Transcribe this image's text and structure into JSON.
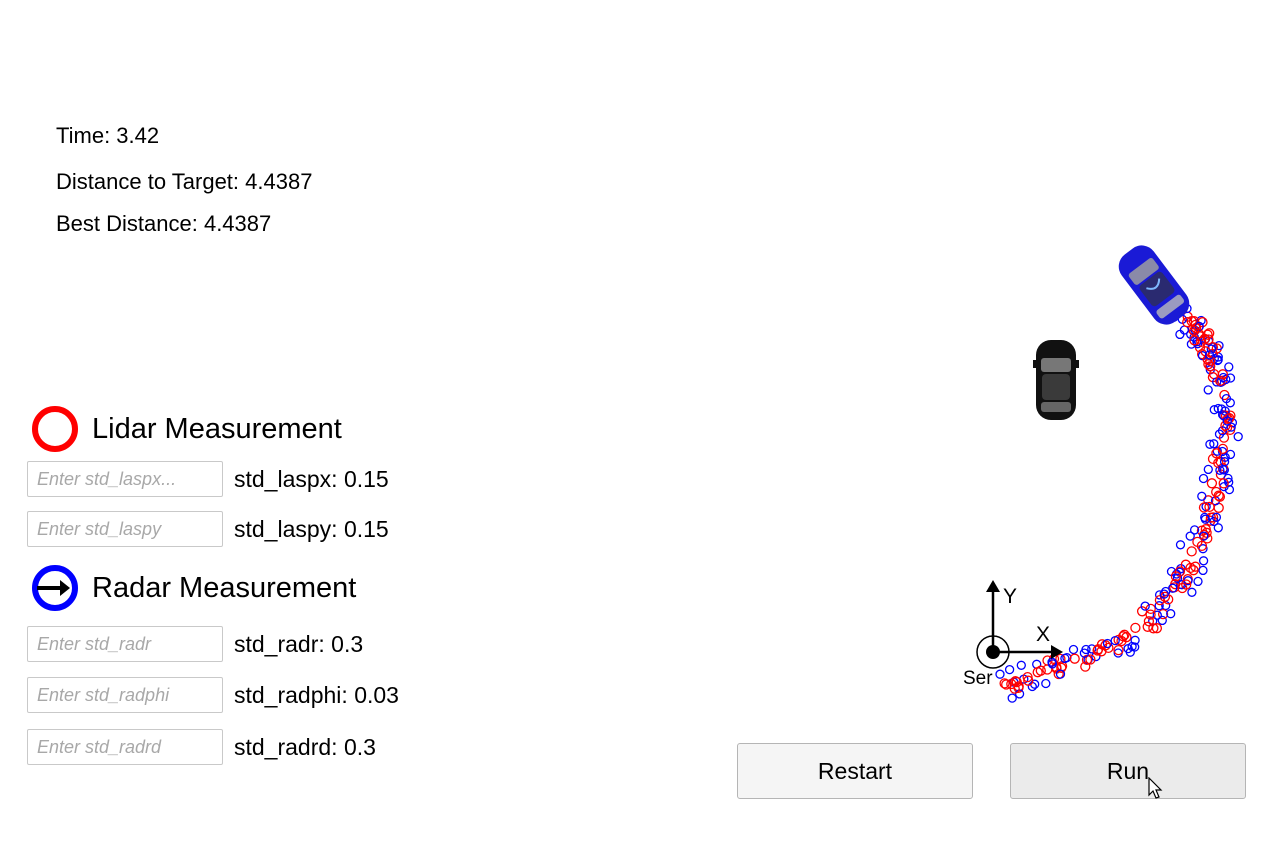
{
  "stats": {
    "time": "Time: 3.42",
    "distance": "Distance to Target: 4.4387",
    "best": "Best Distance: 4.4387"
  },
  "legend": {
    "lidar": "Lidar Measurement",
    "radar": "Radar Measurement",
    "lidar_color": "#ff0000",
    "radar_color": "#0000ff"
  },
  "inputs": {
    "laspx": {
      "placeholder": "Enter std_laspx...",
      "label": "std_laspx: 0.15"
    },
    "laspy": {
      "placeholder": "Enter std_laspy",
      "label": "std_laspy: 0.15"
    },
    "radr": {
      "placeholder": "Enter std_radr",
      "label": "std_radr: 0.3"
    },
    "radphi": {
      "placeholder": "Enter std_radphi",
      "label": "std_radphi: 0.03"
    },
    "radrd": {
      "placeholder": "Enter std_radrd",
      "label": "std_radrd: 0.3"
    }
  },
  "scene": {
    "axis_x": "X",
    "axis_y": "Y",
    "sensor_label": "Ser",
    "target_car_color": "#1a1ad6",
    "estimate_car_color": "#111111"
  },
  "buttons": {
    "restart": "Restart",
    "run": "Run"
  }
}
